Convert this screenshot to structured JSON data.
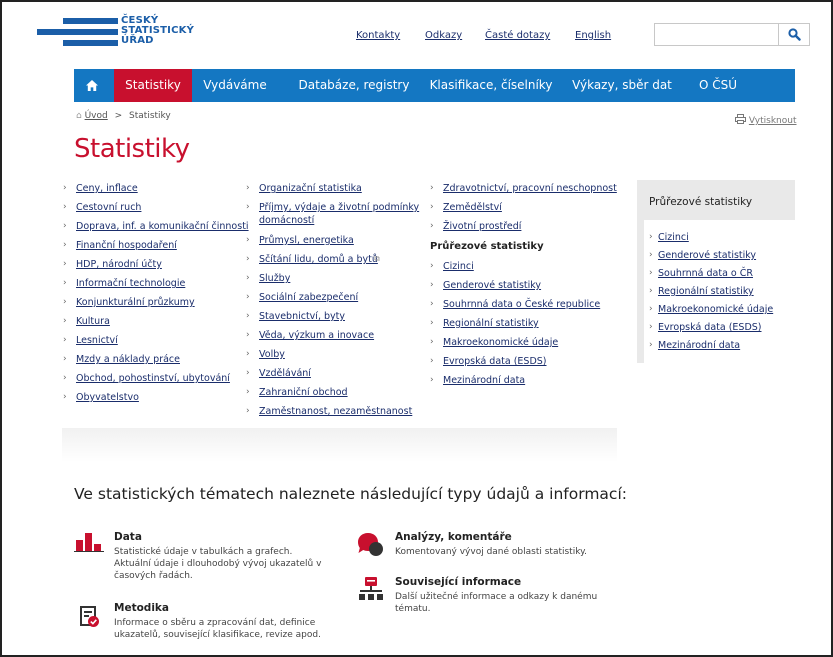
{
  "logo": {
    "line1": "ČESKÝ",
    "line2": "STATISTICKÝ",
    "line3": "ÚŘAD"
  },
  "toplinks": [
    "Kontakty",
    "Odkazy",
    "Časté dotazy",
    "English"
  ],
  "search": {
    "placeholder": "",
    "icon": "search-icon"
  },
  "nav": {
    "home_icon": "home-icon",
    "items": [
      "Statistiky",
      "Vydáváme",
      "Databáze, registry",
      "Klasifikace, číselníky",
      "Výkazy, sběr dat",
      "O ČSÚ"
    ],
    "active_index": 0
  },
  "breadcrumb": {
    "home": "Úvod",
    "sep": ">",
    "current": "Statistiky"
  },
  "print_label": "Vytisknout",
  "page_title": "Statistiky",
  "col1": [
    "Ceny, inflace",
    "Cestovní ruch",
    "Doprava, inf. a komunikační činnosti",
    "Finanční hospodaření",
    "HDP, národní účty",
    "Informační technologie",
    "Konjunkturální průzkumy",
    "Kultura",
    "Lesnictví",
    "Mzdy a náklady práce",
    "Obchod, pohostinství, ubytování",
    "Obyvatelstvo"
  ],
  "col2": [
    "Organizační statistika",
    "Příjmy, výdaje a životní podmínky",
    "domácností",
    "Průmysl, energetika",
    "Sčítání lidu, domů a bytů",
    "Služby",
    "Sociální zabezpečení",
    "Stavebnictví, byty",
    "Věda, výzkum a inovace",
    "Volby",
    "Vzdělávání",
    "Zahraniční obchod",
    "Zaměstnanost, nezaměstnanost"
  ],
  "col3": {
    "items": [
      "Zdravotnictví, pracovní neschopnost",
      "Zemědělství",
      "Životní prostředí"
    ],
    "heading": "Průřezové statistiky",
    "sub": [
      "Cizinci",
      "Genderové statistiky",
      "Souhrnná data o České republice",
      "Regionální statistiky",
      "Makroekonomické údaje",
      "Evropská data (ESDS)",
      "Mezinárodní data"
    ]
  },
  "sidebox": {
    "title": "Průřezové statistiky",
    "items": [
      "Cizinci",
      "Genderové statistiky",
      "Souhrnná data o ČR",
      "Regionální statistiky",
      "Makroekonomické údaje",
      "Evropská data (ESDS)",
      "Mezinárodní data"
    ]
  },
  "info_heading": "Ve statistických tématech naleznete následující typy údajů a informací:",
  "info": {
    "data": {
      "title": "Data",
      "text1": "Statistické údaje v tabulkách a grafech.",
      "text2": "Aktuální údaje i dlouhodobý vývoj ukazatelů v",
      "text3": "časových řadách."
    },
    "metodika": {
      "title": "Metodika",
      "text1": "Informace o sběru a zpracování dat, definice",
      "text2": "ukazatelů, související klasifikace, revize apod."
    },
    "analyzy": {
      "title": "Analýzy, komentáře",
      "text1": "Komentovaný vývoj dané oblasti statistiky."
    },
    "souvisejici": {
      "title": "Související informace",
      "text1": "Další užitečné informace a odkazy k danému",
      "text2": "tématu."
    }
  },
  "colors": {
    "brand_blue": "#1b5ea8",
    "nav_blue": "#1477c2",
    "accent_red": "#c8102e",
    "link": "#1a2d6b"
  }
}
